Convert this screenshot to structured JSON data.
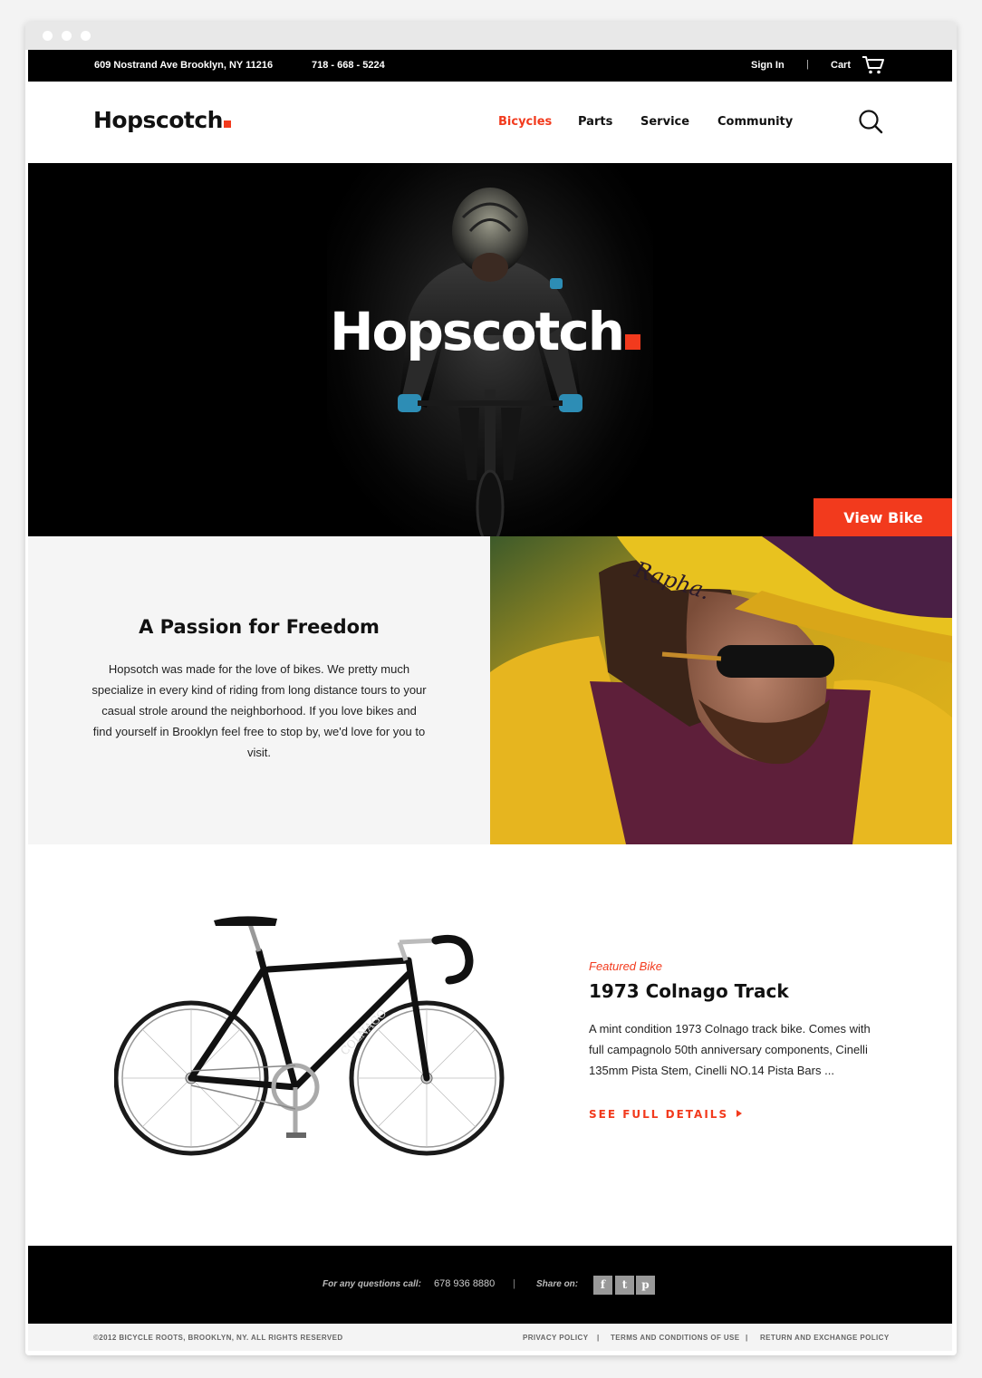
{
  "topbar": {
    "address": "609 Nostrand Ave Brooklyn, NY 11216",
    "phone": "718 - 668 - 5224",
    "sign_in": "Sign In",
    "separator": "|",
    "cart": "Cart",
    "cart_icon": "cart-icon"
  },
  "nav": {
    "logo": "Hopscotch",
    "items": [
      {
        "label": "Bicycles",
        "active": true
      },
      {
        "label": "Parts",
        "active": false
      },
      {
        "label": "Service",
        "active": false
      },
      {
        "label": "Community",
        "active": false
      }
    ],
    "search_icon": "search-icon"
  },
  "hero": {
    "title": "Hopscotch",
    "cta": "View Bike"
  },
  "passion": {
    "heading": "A Passion for Freedom",
    "body": "Hopsotch was made for the love of bikes.  We pretty much specialize in every kind of riding from long distance tours to your casual strole around the neighborhood. If you love bikes and find yourself in Brooklyn feel free to stop by, we'd love for you to visit.",
    "cap_text": "Rapha."
  },
  "featured": {
    "label": "Featured Bike",
    "title": "1973 Colnago Track",
    "description": "A mint condition 1973 Colnago track bike. Comes with full campagnolo 50th anniversary components, Cinelli 135mm Pista Stem, Cinelli NO.14 Pista Bars ...",
    "link": "SEE FULL DETAILS",
    "bike_brand": "COLNAGO"
  },
  "footer": {
    "questions": "For any questions call:",
    "phone": "678 936 8880",
    "separator": "|",
    "share": "Share on:",
    "social": [
      {
        "icon": "facebook-icon",
        "glyph": "f"
      },
      {
        "icon": "twitter-icon",
        "glyph": "t"
      },
      {
        "icon": "pinterest-icon",
        "glyph": "p"
      }
    ]
  },
  "subfooter": {
    "copyright": "©2012 BICYCLE ROOTS, BROOKLYN, NY. ALL RIGHTS RESERVED",
    "links": [
      "PRIVACY POLICY",
      "TERMS AND CONDITIONS OF USE",
      "RETURN AND EXCHANGE POLICY"
    ],
    "separator": "|"
  },
  "colors": {
    "accent": "#f23a1d",
    "black": "#000000",
    "light_gray": "#f5f5f5"
  }
}
